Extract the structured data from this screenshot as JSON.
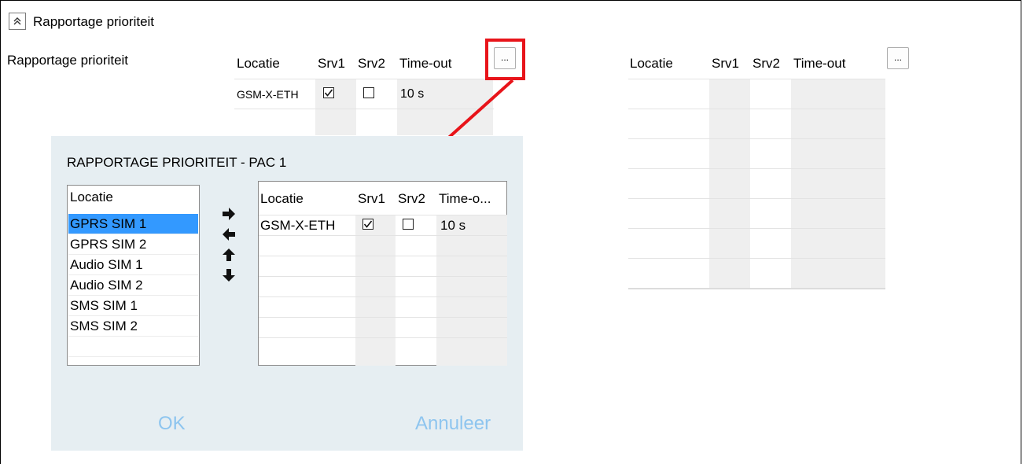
{
  "section": {
    "title": "Rapportage prioriteit",
    "row_label": "Rapportage prioriteit"
  },
  "table_left": {
    "headers": [
      "Locatie",
      "Srv1",
      "Srv2",
      "Time-out"
    ],
    "button_label": "...",
    "row": {
      "location": "GSM-X-ETH",
      "srv1_checked": true,
      "srv2_checked": false,
      "timeout": "10 s"
    }
  },
  "table_right": {
    "headers": [
      "Locatie",
      "Srv1",
      "Srv2",
      "Time-out"
    ],
    "button_label": "..."
  },
  "dialog": {
    "title": "RAPPORTAGE PRIORITEIT - PAC 1",
    "available": {
      "header": "Locatie",
      "items": [
        "GPRS SIM 1",
        "GPRS SIM 2",
        "Audio SIM 1",
        "Audio SIM 2",
        "SMS SIM 1",
        "SMS SIM 2"
      ],
      "selected_index": 0
    },
    "selected": {
      "headers": [
        "Locatie",
        "Srv1",
        "Srv2",
        "Time-o..."
      ],
      "row": {
        "location": "GSM-X-ETH",
        "srv1_checked": true,
        "srv2_checked": false,
        "timeout": "10 s"
      }
    },
    "ok_label": "OK",
    "cancel_label": "Annuleer"
  },
  "icons": {
    "collapse": "double-chevron-up-icon",
    "move_right": "arrow-right-icon",
    "move_left": "arrow-left-icon",
    "move_up": "arrow-up-icon",
    "move_down": "arrow-down-icon"
  },
  "colors": {
    "highlight": "#e8141a",
    "selection": "#3399ff",
    "dialog_bg": "#e6eef2",
    "dialog_button_text": "#8ec5ef"
  }
}
